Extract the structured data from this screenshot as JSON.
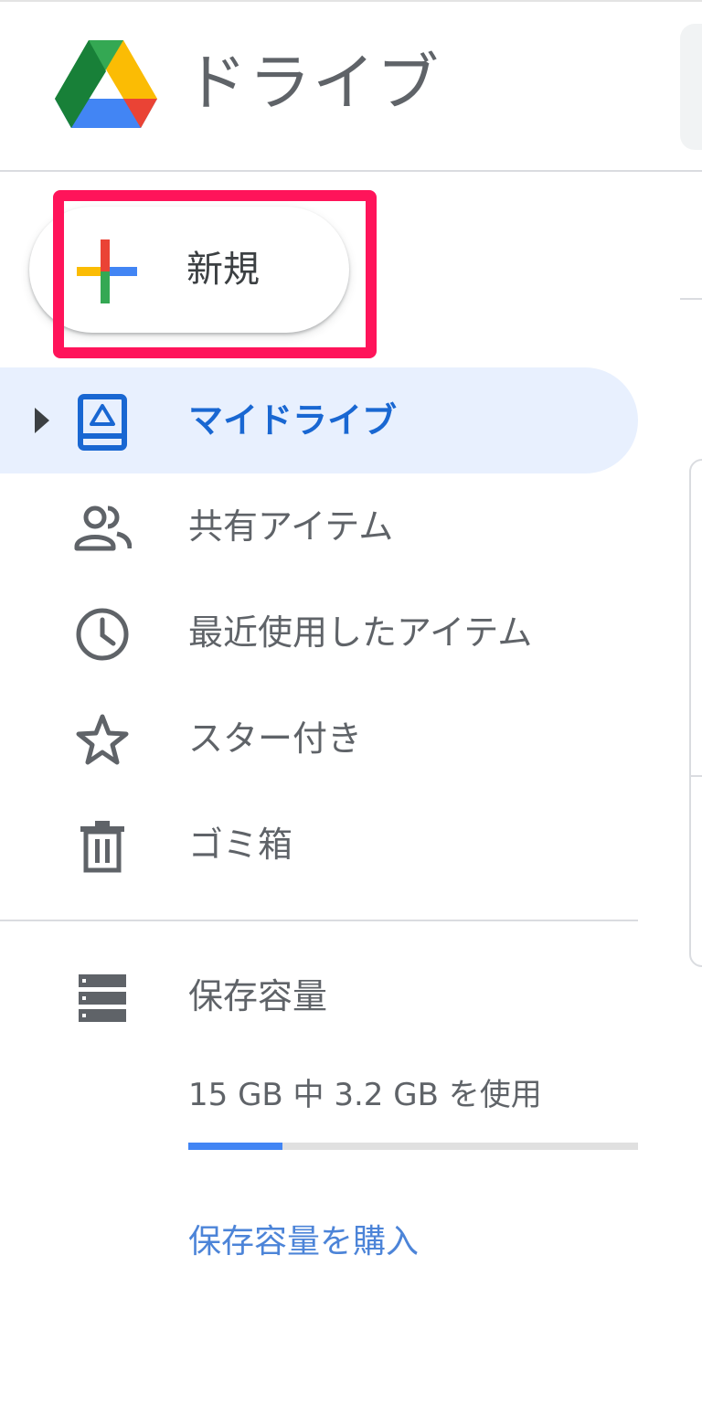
{
  "header": {
    "app_title": "ドライブ",
    "logo_icon": "google-drive-logo-icon"
  },
  "new_button": {
    "label": "新規",
    "icon": "colored-plus-icon",
    "highlight_color": "#ff145a"
  },
  "nav": {
    "items": [
      {
        "label": "マイドライブ",
        "icon": "my-drive-icon",
        "active": true,
        "expandable": true
      },
      {
        "label": "共有アイテム",
        "icon": "people-icon",
        "active": false
      },
      {
        "label": "最近使用したアイテム",
        "icon": "clock-icon",
        "active": false
      },
      {
        "label": "スター付き",
        "icon": "star-icon",
        "active": false
      },
      {
        "label": "ゴミ箱",
        "icon": "trash-icon",
        "active": false
      }
    ]
  },
  "storage": {
    "label": "保存容量",
    "icon": "storage-icon",
    "usage_text": "15 GB 中 3.2 GB を使用",
    "used_fraction": 0.21,
    "buy_label": "保存容量を購入"
  },
  "colors": {
    "active_bg": "#e8f0fe",
    "active_text": "#1967d2",
    "link": "#4c84d8",
    "bar_fill": "#4285f4",
    "bar_track": "#e0e0e0"
  }
}
